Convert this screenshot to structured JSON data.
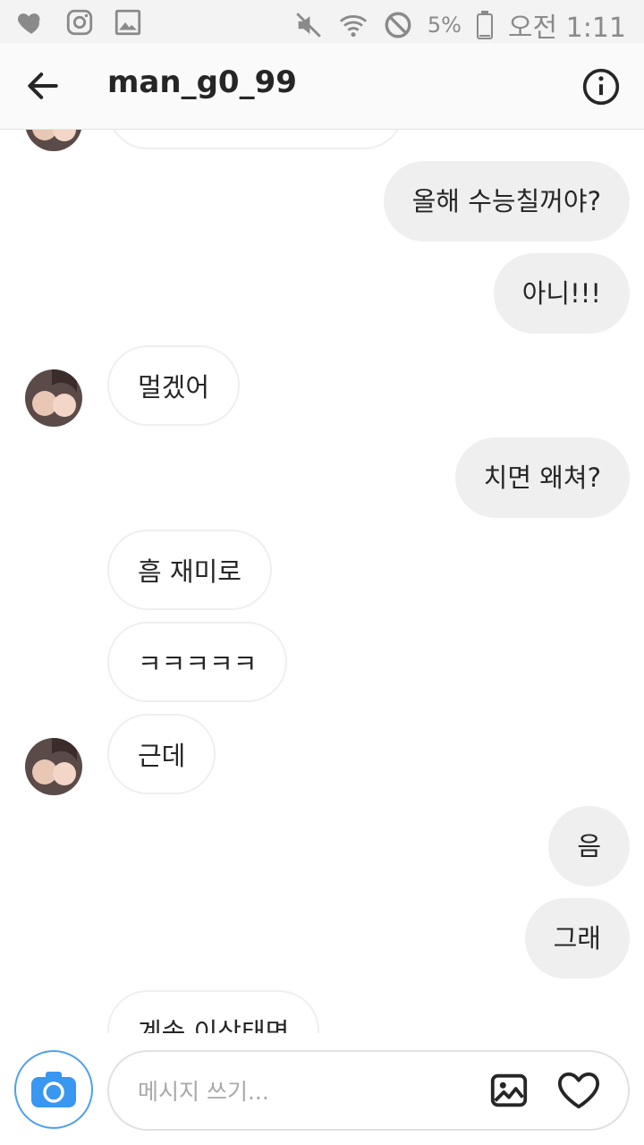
{
  "status_bar": {
    "icons_left": [
      "heart-icon",
      "instagram-icon",
      "image-icon"
    ],
    "icons_right": [
      "mute-icon",
      "wifi-icon",
      "do-not-disturb-icon"
    ],
    "battery": "5%",
    "time": "오전 1:11"
  },
  "header": {
    "username": "man_g0_99"
  },
  "messages": [
    {
      "from": "me",
      "text": "올해 수능칠꺼야?"
    },
    {
      "from": "me",
      "text": "아니!!!"
    },
    {
      "from": "them",
      "text": "멀겠어"
    },
    {
      "from": "me",
      "text": "치면 왜쳐?"
    },
    {
      "from": "them",
      "text": "흠 재미로"
    },
    {
      "from": "them",
      "text": "ㅋㅋㅋㅋㅋ"
    },
    {
      "from": "them",
      "text": "근데"
    },
    {
      "from": "me",
      "text": "음"
    },
    {
      "from": "me",
      "text": "그래"
    },
    {
      "from": "them",
      "text": "계속 이상태면"
    }
  ],
  "composer": {
    "placeholder": "메시지 쓰기..."
  },
  "colors": {
    "accent": "#3897f0",
    "bubble_me": "#efefef",
    "bubble_them_border": "#efefef"
  }
}
